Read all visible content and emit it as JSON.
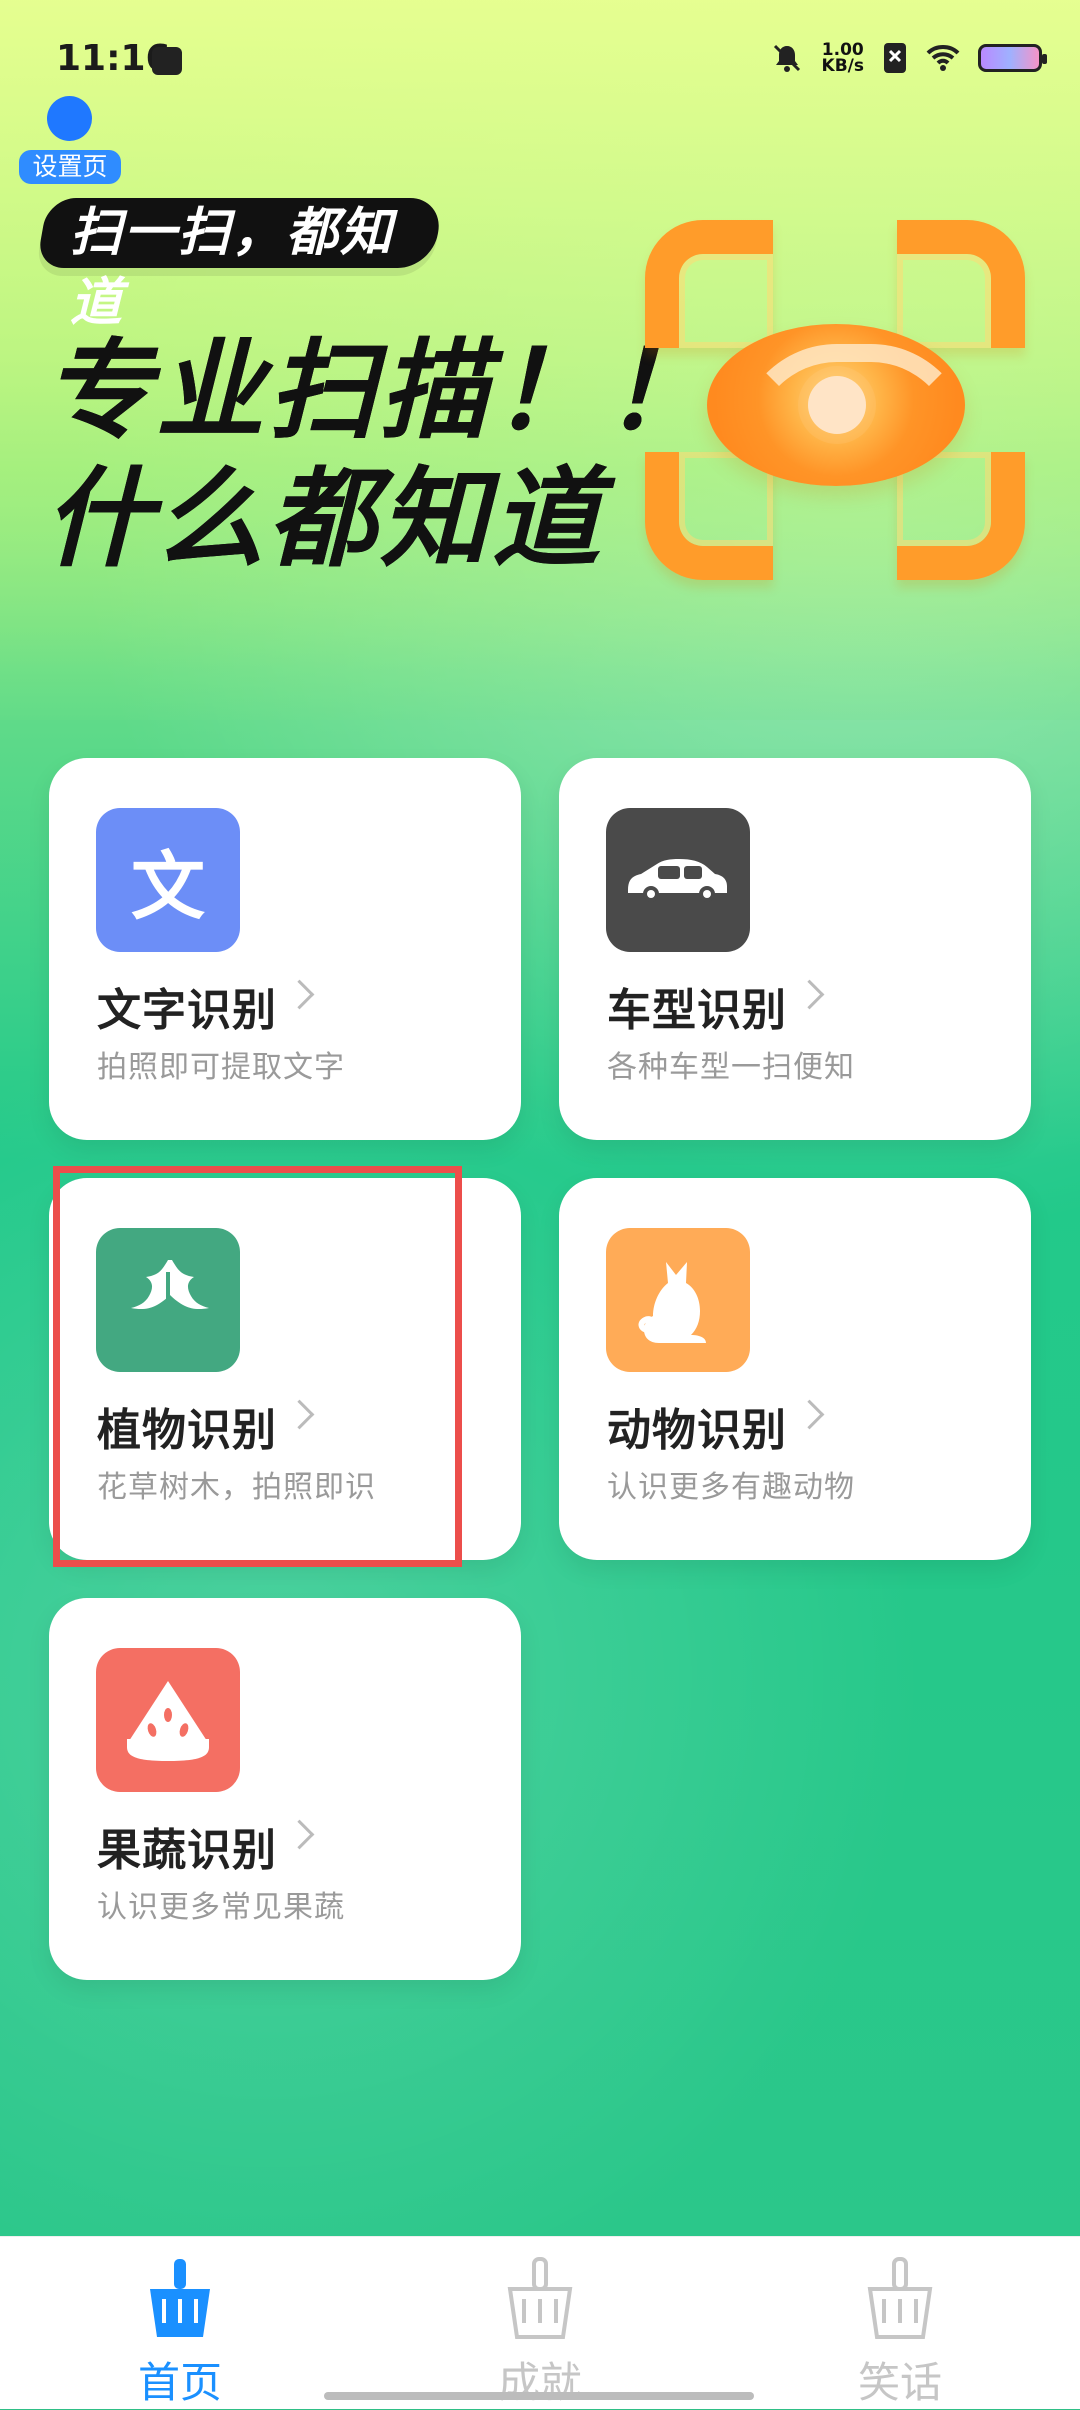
{
  "status_bar": {
    "time": "11:16",
    "network_speed": "1.00\nKB/s"
  },
  "floating": {
    "settings_tag": "设置页"
  },
  "hero": {
    "tagline": "扫一扫，都知道",
    "headline_1": "专业扫描！！",
    "headline_2": "什么都知道"
  },
  "cards": [
    {
      "title": "文字识别",
      "subtitle": "拍照即可提取文字",
      "icon": "text-icon",
      "icon_bg": "#6c8ef7",
      "icon_text": "文"
    },
    {
      "title": "车型识别",
      "subtitle": "各种车型一扫便知",
      "icon": "car-icon",
      "icon_bg": "#4a4a4a"
    },
    {
      "title": "植物识别",
      "subtitle": "花草树木，拍照即识",
      "icon": "leaf-icon",
      "icon_bg": "#43a881"
    },
    {
      "title": "动物识别",
      "subtitle": "认识更多有趣动物",
      "icon": "cat-icon",
      "icon_bg": "#ffab57"
    },
    {
      "title": "果蔬识别",
      "subtitle": "认识更多常见果蔬",
      "icon": "watermelon-icon",
      "icon_bg": "#f46f63"
    }
  ],
  "tabs": [
    {
      "label": "首页",
      "active": true,
      "icon": "broom-icon"
    },
    {
      "label": "成就",
      "active": false,
      "icon": "broom-icon"
    },
    {
      "label": "笑话",
      "active": false,
      "icon": "broom-icon"
    }
  ],
  "colors": {
    "active_tab": "#1a90ff",
    "highlight": "#ec4e4b"
  }
}
